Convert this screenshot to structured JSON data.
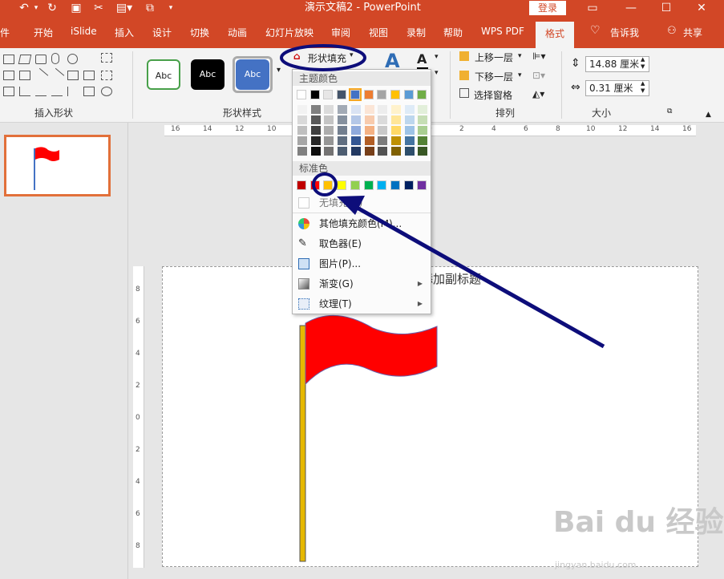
{
  "titlebar": {
    "title": "演示文稿2  -  PowerPoint",
    "login": "登录",
    "icons": [
      "undo-icon",
      "redo-icon",
      "repeat-icon",
      "cut-icon",
      "quick-access-icon",
      "restore-window-icon",
      "minimize-icon",
      "maximize-icon",
      "close-icon"
    ]
  },
  "tabs": [
    "件",
    "开始",
    "iSlide",
    "插入",
    "设计",
    "切换",
    "动画",
    "幻灯片放映",
    "审阅",
    "视图",
    "录制",
    "帮助",
    "WPS PDF",
    "格式"
  ],
  "tell_me": "告诉我",
  "share": "共享",
  "ribbon": {
    "insert_shapes_label": "插入形状",
    "shape_styles_label": "形状样式",
    "style_sample": "Abc",
    "shape_fill_button": "形状填充",
    "arrange_label": "排列",
    "bring_forward": "上移一层",
    "send_backward": "下移一层",
    "selection_pane": "选择窗格",
    "size_label": "大小",
    "height_value": "14.88 厘米",
    "width_value": "0.31 厘米"
  },
  "dropdown": {
    "theme_colors_header": "主题颜色",
    "standard_colors_header": "标准色",
    "no_fill": "无填充(N)",
    "more_fill_colors": "其他填充颜色(M)...",
    "eyedropper": "取色器(E)",
    "picture": "图片(P)...",
    "gradient": "渐变(G)",
    "texture": "纹理(T)",
    "theme_colors": [
      "#ffffff",
      "#000000",
      "#e7e6e6",
      "#44546a",
      "#4472c4",
      "#ed7d31",
      "#a5a5a5",
      "#ffc000",
      "#5b9bd5",
      "#70ad47"
    ],
    "standard_colors": [
      "#c00000",
      "#ff0000",
      "#ffc000",
      "#ffff00",
      "#92d050",
      "#00b050",
      "#00b0f0",
      "#0070c0",
      "#002060",
      "#7030a0"
    ]
  },
  "ruler": {
    "h_labels": [
      "16",
      "14",
      "12",
      "10",
      "8",
      "6",
      "4",
      "2",
      "0",
      "2",
      "4",
      "6",
      "8",
      "10",
      "12",
      "14",
      "16"
    ],
    "v_labels": [
      "8",
      "6",
      "4",
      "2",
      "0",
      "2",
      "4",
      "6",
      "8"
    ]
  },
  "slide": {
    "subtitle_placeholder": "添加副标题",
    "flag_color": "#ff0000",
    "pole_color": "#e6b800"
  },
  "annotation": {
    "color": "#0d0d7a"
  },
  "watermark": {
    "text": "Bai du 经验",
    "sub": "jingyan.baidu.com"
  }
}
